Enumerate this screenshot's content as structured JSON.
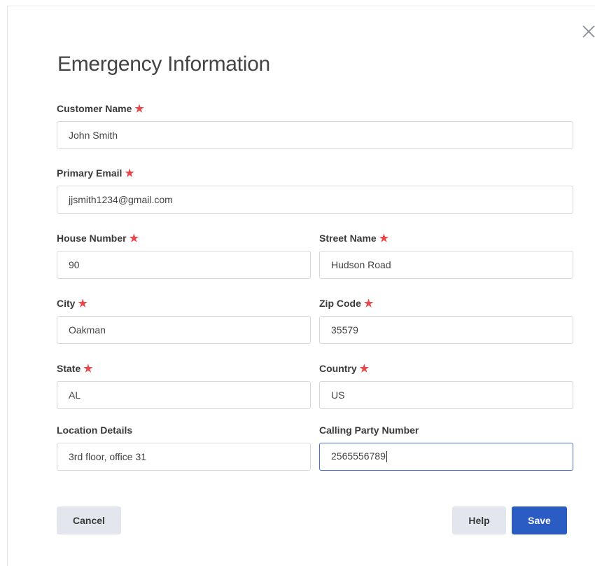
{
  "dialog": {
    "title": "Emergency Information",
    "close_icon": "close-icon"
  },
  "fields": {
    "customer_name": {
      "label": "Customer Name",
      "required": "★",
      "value": "John Smith"
    },
    "primary_email": {
      "label": "Primary Email",
      "required": "★",
      "value": "jjsmith1234@gmail.com"
    },
    "house_number": {
      "label": "House Number",
      "required": "★",
      "value": "90"
    },
    "street_name": {
      "label": "Street Name",
      "required": "★",
      "value": "Hudson Road"
    },
    "city": {
      "label": "City",
      "required": "★",
      "value": "Oakman"
    },
    "zip_code": {
      "label": "Zip Code",
      "required": "★",
      "value": "35579"
    },
    "state": {
      "label": "State",
      "required": "★",
      "value": "AL"
    },
    "country": {
      "label": "Country",
      "required": "★",
      "value": "US"
    },
    "location_details": {
      "label": "Location Details",
      "value": "3rd floor, office 31"
    },
    "calling_party_number": {
      "label": "Calling Party Number",
      "value": "2565556789"
    }
  },
  "buttons": {
    "cancel": "Cancel",
    "help": "Help",
    "save": "Save"
  },
  "colors": {
    "required_star": "#e8474b",
    "primary_button": "#2a5cc4",
    "secondary_button": "#e3e6ed",
    "focus_border": "#4a6fd2"
  }
}
